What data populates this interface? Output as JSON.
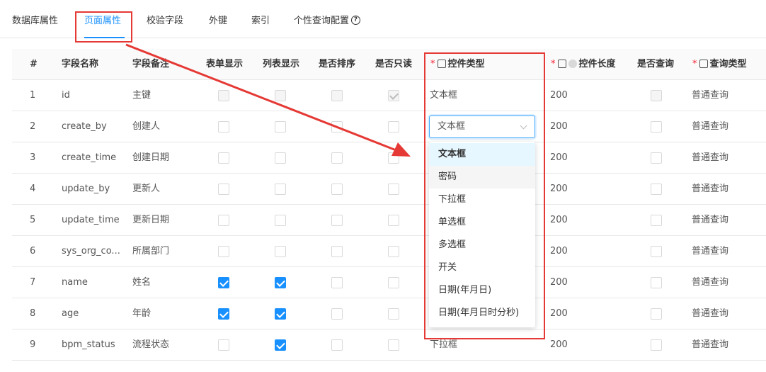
{
  "tabs": {
    "items": [
      {
        "label": "数据库属性"
      },
      {
        "label": "页面属性"
      },
      {
        "label": "校验字段"
      },
      {
        "label": "外键"
      },
      {
        "label": "索引"
      },
      {
        "label": "个性查询配置"
      }
    ],
    "active_index": 1,
    "help_glyph": "?"
  },
  "table": {
    "required_mark": "*",
    "headers": {
      "index": "#",
      "field_name": "字段名称",
      "field_comment": "字段备注",
      "form_show": "表单显示",
      "list_show": "列表显示",
      "sortable": "是否排序",
      "readonly": "是否只读",
      "control_type": "控件类型",
      "control_length": "控件长度",
      "is_query": "是否查询",
      "query_type": "查询类型"
    },
    "rows": [
      {
        "index": "1",
        "name": "id",
        "comment": "主键",
        "form": false,
        "list": false,
        "sort": false,
        "readonly": true,
        "type": "文本框",
        "length": "200",
        "query": false,
        "query_type": "普通查询",
        "disabled": true
      },
      {
        "index": "2",
        "name": "create_by",
        "comment": "创建人",
        "form": false,
        "list": false,
        "sort": false,
        "readonly": false,
        "type": "",
        "length": "200",
        "query": false,
        "query_type": "普通查询",
        "disabled": false
      },
      {
        "index": "3",
        "name": "create_time",
        "comment": "创建日期",
        "form": false,
        "list": false,
        "sort": false,
        "readonly": false,
        "type": "",
        "length": "200",
        "query": false,
        "query_type": "普通查询",
        "disabled": false
      },
      {
        "index": "4",
        "name": "update_by",
        "comment": "更新人",
        "form": false,
        "list": false,
        "sort": false,
        "readonly": false,
        "type": "",
        "length": "200",
        "query": false,
        "query_type": "普通查询",
        "disabled": false
      },
      {
        "index": "5",
        "name": "update_time",
        "comment": "更新日期",
        "form": false,
        "list": false,
        "sort": false,
        "readonly": false,
        "type": "",
        "length": "200",
        "query": false,
        "query_type": "普通查询",
        "disabled": false
      },
      {
        "index": "6",
        "name": "sys_org_co...",
        "comment": "所属部门",
        "form": false,
        "list": false,
        "sort": false,
        "readonly": false,
        "type": "",
        "length": "200",
        "query": false,
        "query_type": "普通查询",
        "disabled": false
      },
      {
        "index": "7",
        "name": "name",
        "comment": "姓名",
        "form": true,
        "list": true,
        "sort": false,
        "readonly": false,
        "type": "",
        "length": "200",
        "query": false,
        "query_type": "普通查询",
        "disabled": false
      },
      {
        "index": "8",
        "name": "age",
        "comment": "年龄",
        "form": true,
        "list": true,
        "sort": false,
        "readonly": false,
        "type": "",
        "length": "200",
        "query": false,
        "query_type": "普通查询",
        "disabled": false
      },
      {
        "index": "9",
        "name": "bpm_status",
        "comment": "流程状态",
        "form": false,
        "list": true,
        "sort": false,
        "readonly": false,
        "type": "下拉框",
        "length": "200",
        "query": false,
        "query_type": "普通查询",
        "disabled": false
      }
    ]
  },
  "control_select": {
    "value": "文本框",
    "options": [
      "文本框",
      "密码",
      "下拉框",
      "单选框",
      "多选框",
      "开关",
      "日期(年月日)",
      "日期(年月日时分秒)"
    ],
    "selected_index": 0,
    "hover_index": 1
  },
  "annotation_color": "#e53935",
  "accent_color": "#1890ff"
}
